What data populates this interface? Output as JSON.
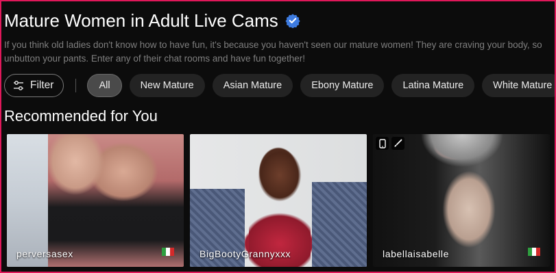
{
  "page": {
    "title": "Mature Women in Adult Live Cams",
    "description": "If you think old ladies don't know how to have fun, it's because you haven't seen our mature women! They are craving your body, so unbutton your pants. Enter any of their chat rooms and have fun together!"
  },
  "filters": {
    "filter_label": "Filter",
    "tags": [
      "All",
      "New Mature",
      "Asian Mature",
      "Ebony Mature",
      "Latina Mature",
      "White Mature"
    ]
  },
  "recommended": {
    "heading": "Recommended for You",
    "cards": [
      {
        "username": "perversasex",
        "flag": "italy-flag",
        "flag_colors": [
          "#2e9e3f",
          "#ffffff",
          "#d42a2a"
        ]
      },
      {
        "username": "BigBootyGrannyxxx"
      },
      {
        "username": "labellaisabelle",
        "flag": "italy-flag",
        "flag_colors": [
          "#2e9e3f",
          "#ffffff",
          "#d42a2a"
        ],
        "icons": [
          "mobile-icon",
          "brush-icon"
        ]
      }
    ]
  },
  "colors": {
    "accent_border": "#e0185a",
    "verified_badge": "#3d7be0"
  }
}
